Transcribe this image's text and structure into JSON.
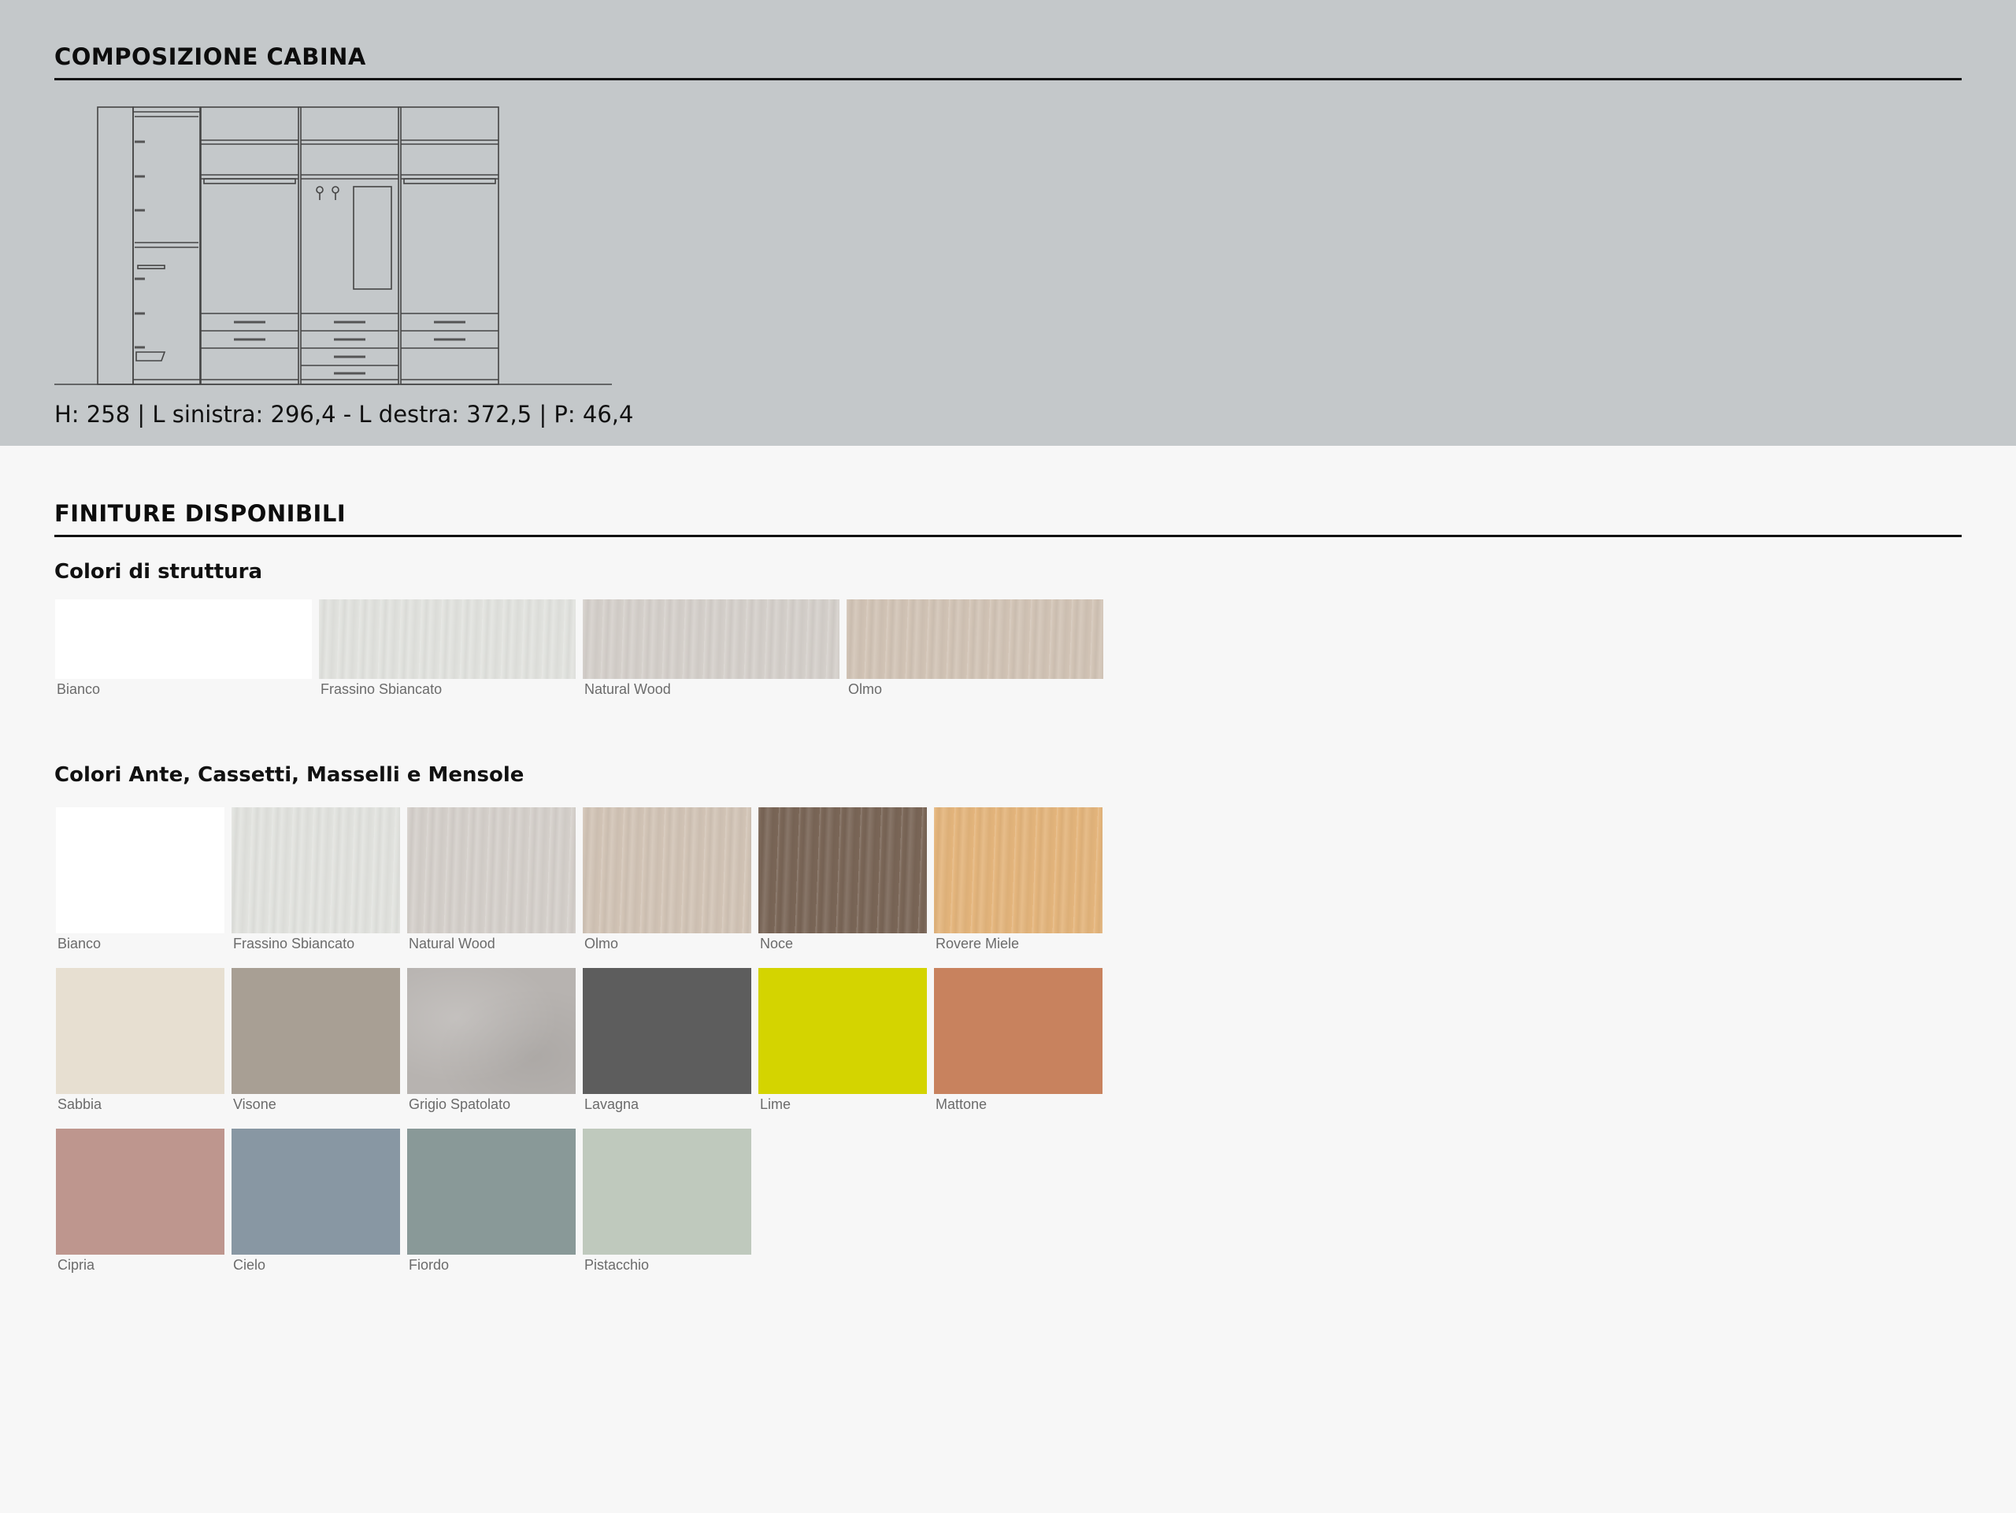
{
  "cabina": {
    "title": "COMPOSIZIONE CABINA",
    "dimensions": "H: 258 | L sinistra: 296,4 - L destra: 372,5 | P: 46,4"
  },
  "finiture": {
    "title": "FINITURE DISPONIBILI",
    "struttura": {
      "title": "Colori di struttura",
      "items": [
        {
          "name": "Bianco",
          "color": "#ffffff",
          "texture": "none"
        },
        {
          "name": "Frassino Sbiancato",
          "color": "#e2e3df",
          "texture": "wood"
        },
        {
          "name": "Natural Wood",
          "color": "#d5d0cb",
          "texture": "wood"
        },
        {
          "name": "Olmo",
          "color": "#d2c4b6",
          "texture": "wood"
        }
      ]
    },
    "ante": {
      "title": "Colori Ante, Cassetti, Masselli e Mensole",
      "items": [
        {
          "name": "Bianco",
          "color": "#ffffff",
          "texture": "none"
        },
        {
          "name": "Frassino Sbiancato",
          "color": "#e2e3df",
          "texture": "wood"
        },
        {
          "name": "Natural Wood",
          "color": "#d5d0cb",
          "texture": "wood"
        },
        {
          "name": "Olmo",
          "color": "#d2c4b6",
          "texture": "wood"
        },
        {
          "name": "Noce",
          "color": "#7a6657",
          "texture": "wood"
        },
        {
          "name": "Rovere Miele",
          "color": "#e4b57c",
          "texture": "wood"
        },
        {
          "name": "Sabbia",
          "color": "#e7dfd1",
          "texture": "none"
        },
        {
          "name": "Visone",
          "color": "#a89f94",
          "texture": "none"
        },
        {
          "name": "Grigio Spatolato",
          "color": "#b7b3b0",
          "texture": "concrete"
        },
        {
          "name": "Lavagna",
          "color": "#5d5d5d",
          "texture": "none"
        },
        {
          "name": "Lime",
          "color": "#d4d400",
          "texture": "none"
        },
        {
          "name": "Mattone",
          "color": "#c8825e",
          "texture": "none"
        },
        {
          "name": "Cipria",
          "color": "#be968e",
          "texture": "none"
        },
        {
          "name": "Cielo",
          "color": "#8897a3",
          "texture": "none"
        },
        {
          "name": "Fiordo",
          "color": "#899998",
          "texture": "none"
        },
        {
          "name": "Pistacchio",
          "color": "#bfc9bd",
          "texture": "none"
        }
      ]
    }
  }
}
